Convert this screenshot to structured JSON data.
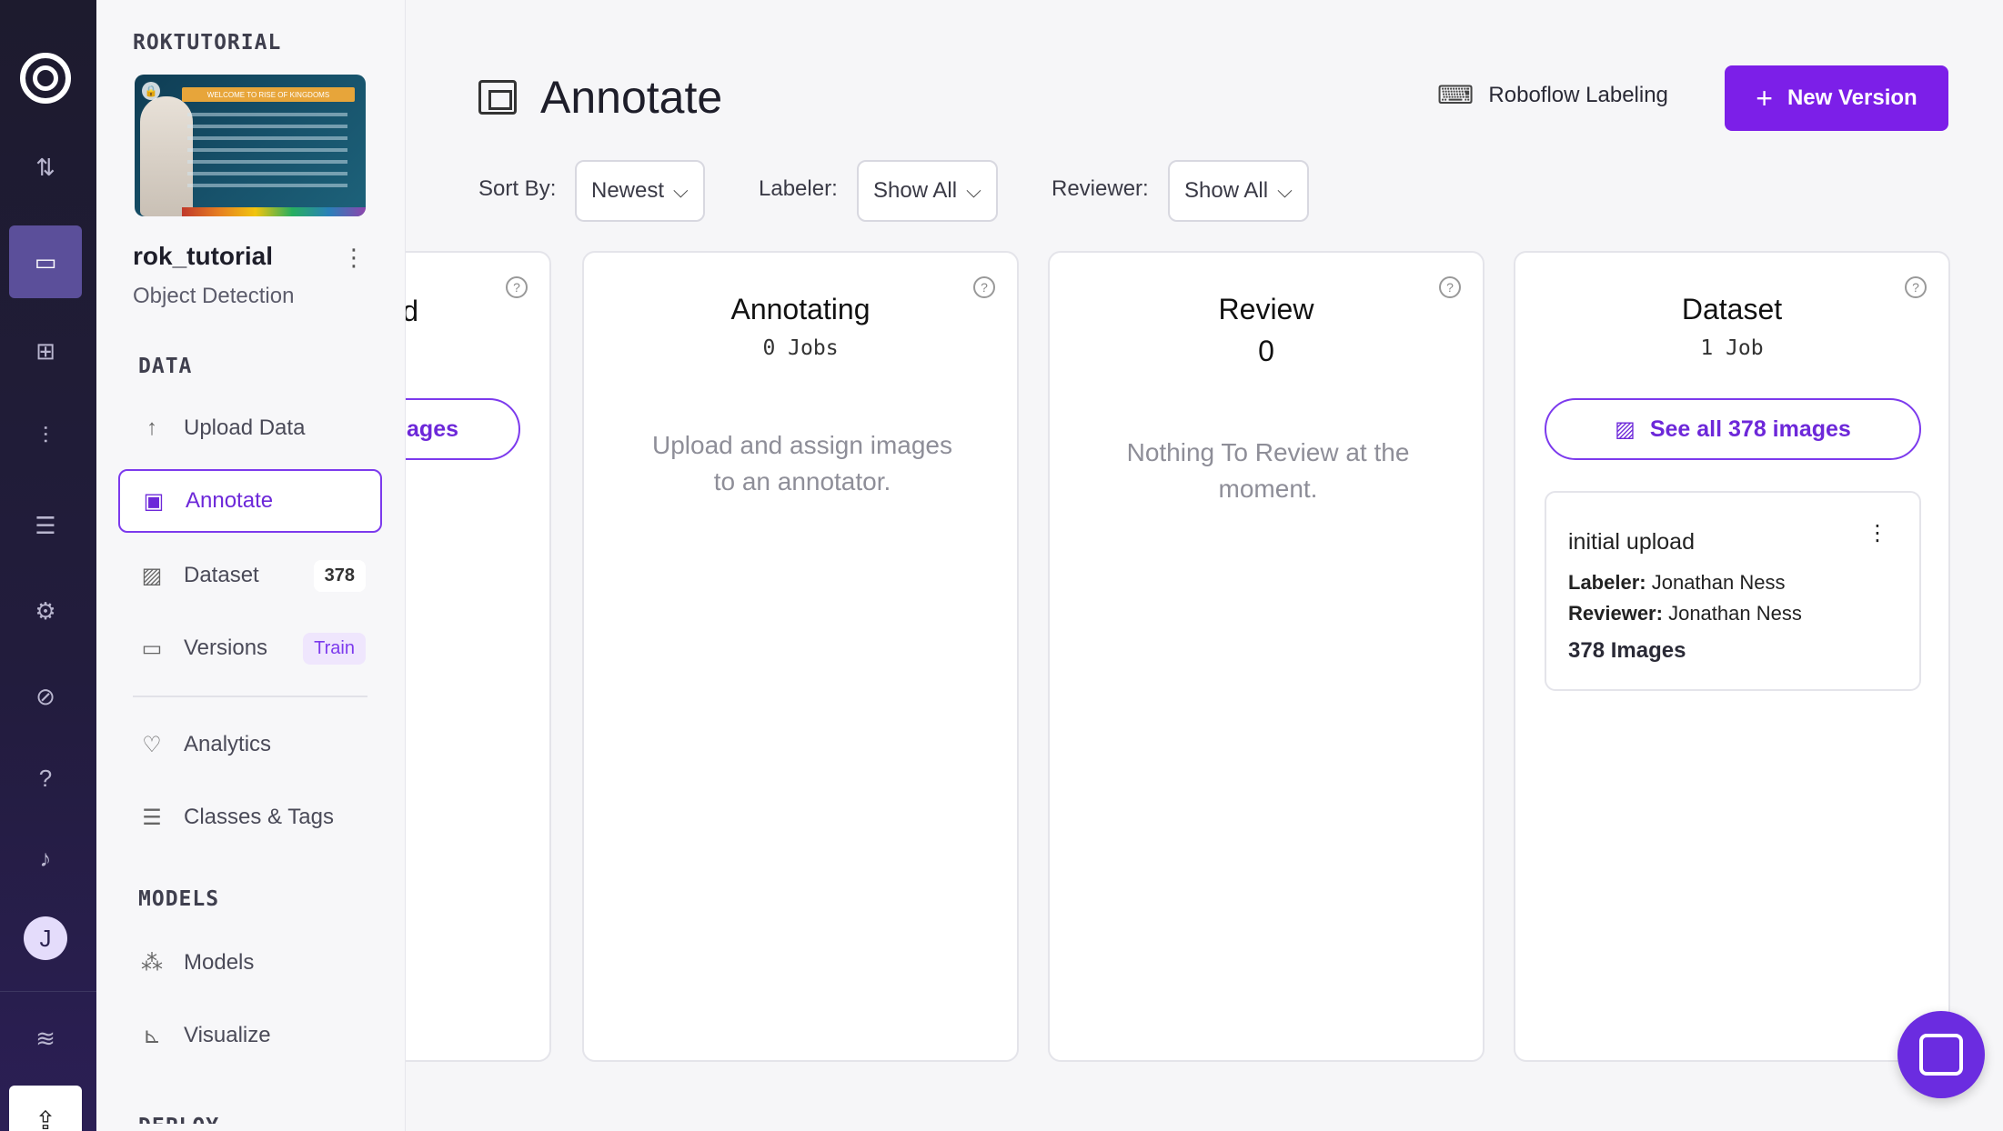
{
  "rail": {
    "avatar_letter": "J",
    "icons": [
      "logo-icon",
      "sort-icon",
      "inbox-icon",
      "hierarchy-icon",
      "chart-icon",
      "storage-icon",
      "gear-icon",
      "planet-icon",
      "help-icon",
      "bell-icon",
      "database-icon",
      "upload-icon"
    ]
  },
  "sidebar": {
    "project_header": "ROKTUTORIAL",
    "project_name": "rok_tutorial",
    "project_type": "Object Detection",
    "thumbnail_banner": "WELCOME TO RISE OF KINGDOMS",
    "section_data": "DATA",
    "section_models": "MODELS",
    "section_deploy": "DEPLOY",
    "items": {
      "upload": "Upload Data",
      "annotate": "Annotate",
      "dataset": "Dataset",
      "dataset_count": "378",
      "versions": "Versions",
      "versions_badge": "Train",
      "analytics": "Analytics",
      "classes": "Classes & Tags",
      "models": "Models",
      "visualize": "Visualize"
    }
  },
  "header": {
    "title": "Annotate",
    "labeling_link": "Roboflow Labeling",
    "new_version": "New Version"
  },
  "filters": {
    "sort_label": "Sort By:",
    "sort_value": "Newest",
    "labeler_label": "Labeler:",
    "labeler_value": "Show All",
    "reviewer_label": "Reviewer:",
    "reviewer_value": "Show All"
  },
  "columns": {
    "unassigned": {
      "title_fragment": "d",
      "button_fragment": "ages"
    },
    "annotating": {
      "title": "Annotating",
      "subtitle": "0 Jobs",
      "empty": "Upload and assign images to an annotator."
    },
    "review": {
      "title": "Review",
      "count": "0",
      "empty": "Nothing To Review at the moment."
    },
    "dataset": {
      "title": "Dataset",
      "subtitle": "1 Job",
      "see_all": "See all 378 images",
      "job": {
        "title": "initial upload",
        "labeler_label": "Labeler:",
        "labeler_value": "Jonathan Ness",
        "reviewer_label": "Reviewer:",
        "reviewer_value": "Jonathan Ness",
        "images": "378 Images"
      }
    }
  },
  "colors": {
    "accent": "#7c1fe8",
    "accent_text": "#6d28d9",
    "rail_bg": "#1d1b2e"
  }
}
